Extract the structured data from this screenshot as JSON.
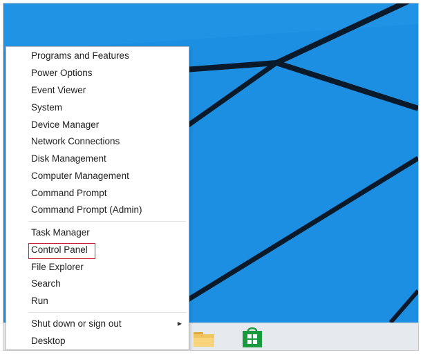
{
  "menu": {
    "group1": [
      {
        "label": "Programs and Features"
      },
      {
        "label": "Power Options"
      },
      {
        "label": "Event Viewer"
      },
      {
        "label": "System"
      },
      {
        "label": "Device Manager"
      },
      {
        "label": "Network Connections"
      },
      {
        "label": "Disk Management"
      },
      {
        "label": "Computer Management"
      },
      {
        "label": "Command Prompt"
      },
      {
        "label": "Command Prompt (Admin)"
      }
    ],
    "group2": [
      {
        "label": "Task Manager"
      },
      {
        "label": "Control Panel",
        "highlighted": true
      },
      {
        "label": "File Explorer"
      },
      {
        "label": "Search"
      },
      {
        "label": "Run"
      }
    ],
    "group3": [
      {
        "label": "Shut down or sign out",
        "has_submenu": true
      },
      {
        "label": "Desktop"
      }
    ]
  },
  "taskbar": {
    "items": [
      {
        "icon": "file-explorer-icon"
      },
      {
        "icon": "windows-store-icon"
      }
    ]
  },
  "colors": {
    "desktop_blue": "#1d8fe2",
    "highlight_border": "#c8232c",
    "store_green": "#1a9a3e",
    "folder_yellow": "#f2c55c"
  }
}
